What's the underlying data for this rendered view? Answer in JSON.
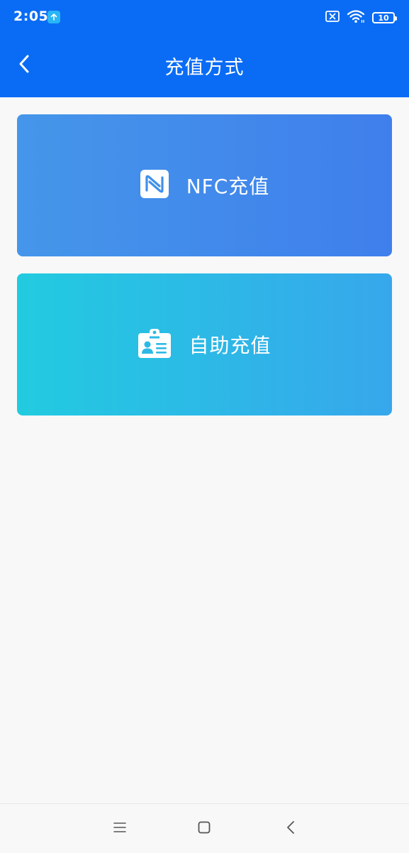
{
  "status_bar": {
    "time": "2:05",
    "battery_level": "10",
    "icons": [
      "upload-icon",
      "sim-blocked-icon",
      "wifi-icon",
      "battery-icon"
    ]
  },
  "header": {
    "title": "充值方式",
    "back_icon": "chevron-left-icon"
  },
  "options": [
    {
      "label": "NFC充值",
      "icon": "nfc-icon"
    },
    {
      "label": "自助充值",
      "icon": "id-badge-icon"
    }
  ],
  "nav_bar": {
    "icons": [
      "menu-icon",
      "home-square-icon",
      "back-icon"
    ]
  },
  "colors": {
    "header_bg": "#0a6cf5",
    "nfc_card_gradient": [
      "#4596ea",
      "#3f7fec"
    ],
    "self_card_gradient": [
      "#22cbe0",
      "#37a7ec"
    ],
    "page_bg": "#f8f8f8"
  }
}
